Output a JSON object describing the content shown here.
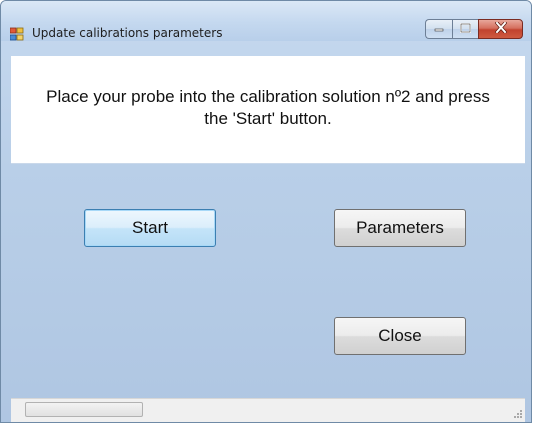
{
  "window": {
    "title": "Update calibrations parameters",
    "title_icon": "app-window-icon"
  },
  "caption_buttons": {
    "minimize_icon": "minimize-icon",
    "maximize_icon": "maximize-icon",
    "close_icon": "close-icon"
  },
  "message": {
    "line1": "Place your probe into the calibration solution nº2 and press",
    "line2": "the 'Start' button."
  },
  "buttons": {
    "start_label": "Start",
    "parameters_label": "Parameters",
    "close_label": "Close"
  },
  "status": {
    "progress_fraction": 0,
    "grip_icon": "resize-grip-icon"
  },
  "colors": {
    "window_bg": "#b9cfe8",
    "close_button": "#c1432f",
    "focus_border": "#3c7fb1"
  }
}
